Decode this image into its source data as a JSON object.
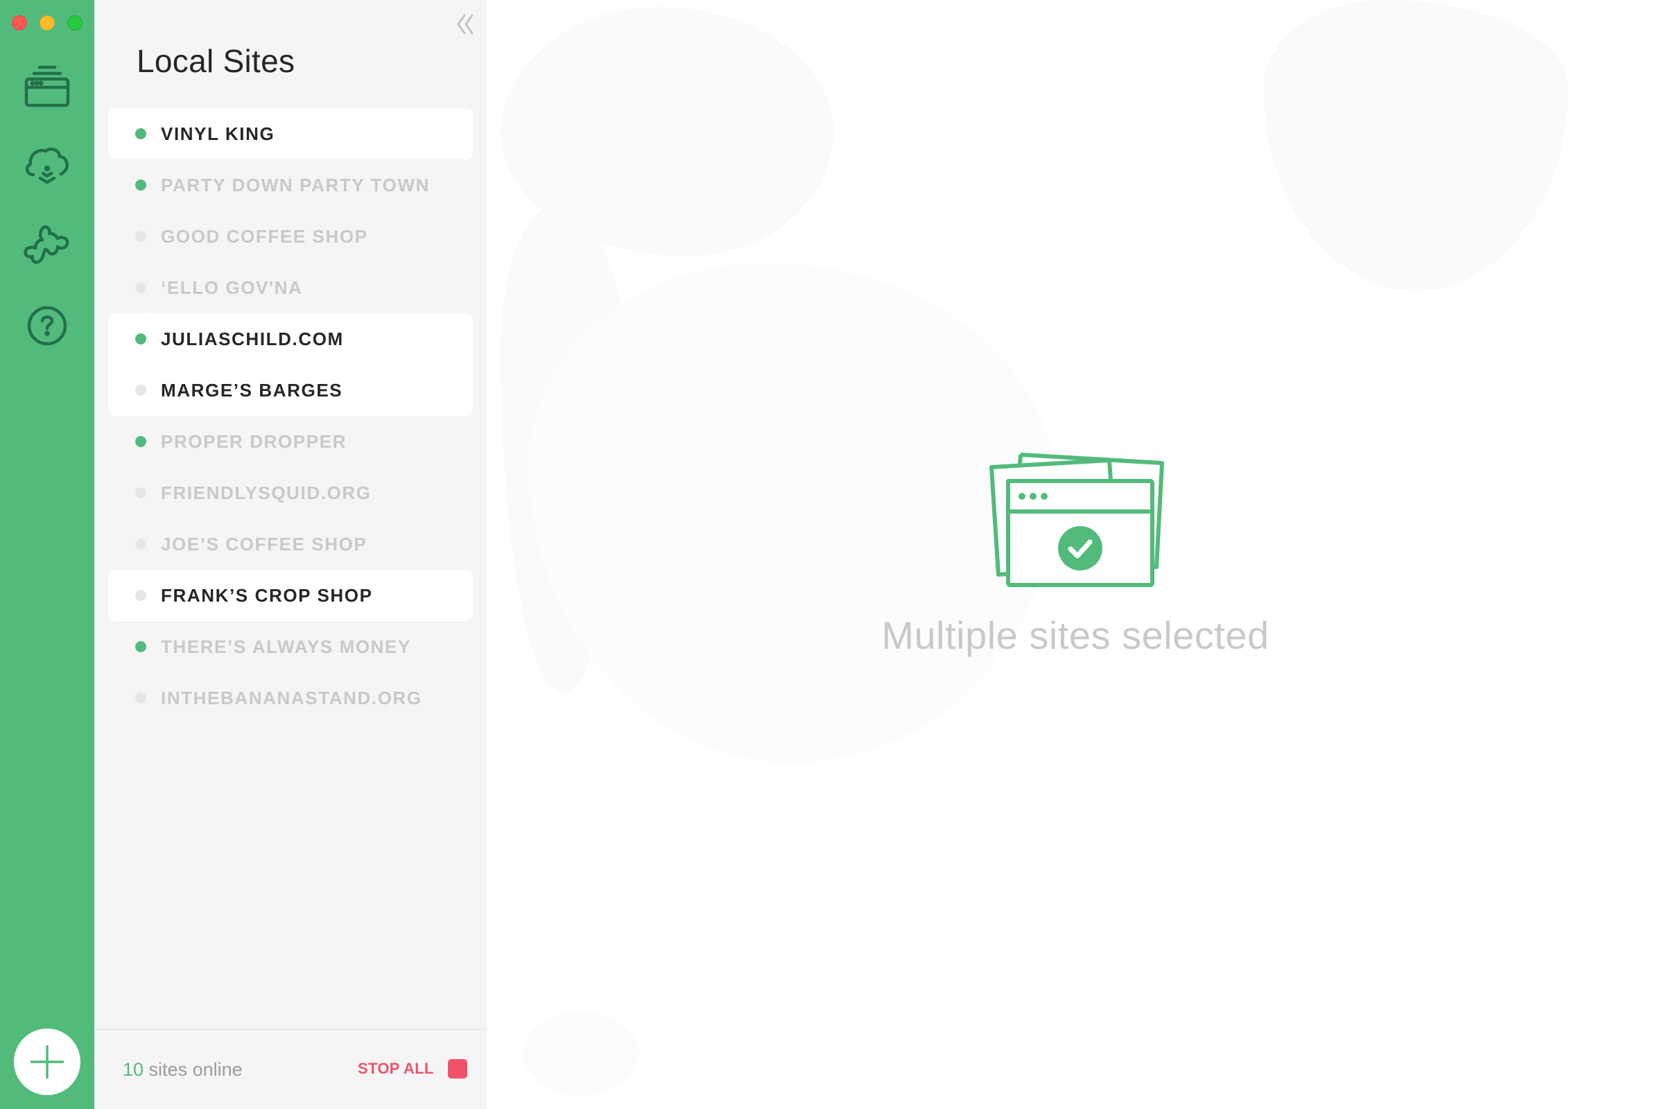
{
  "window": {
    "traffic_lights": [
      "close",
      "minimize",
      "maximize"
    ]
  },
  "rail": {
    "items": [
      {
        "id": "sites",
        "icon": "sites-stack-icon",
        "label": "Local Sites"
      },
      {
        "id": "connect",
        "icon": "cloud-download-icon",
        "label": "Connect"
      },
      {
        "id": "addons",
        "icon": "puzzle-icon",
        "label": "Add-ons"
      },
      {
        "id": "help",
        "icon": "help-circle-icon",
        "label": "Help"
      }
    ],
    "add_button_icon": "plus-icon"
  },
  "panel": {
    "title": "Local Sites",
    "collapse_icon": "double-chevron-left-icon",
    "sites": [
      {
        "name": "VINYL KING",
        "online": true,
        "selected": true
      },
      {
        "name": "PARTY DOWN PARTY TOWN",
        "online": true,
        "selected": false
      },
      {
        "name": "GOOD COFFEE SHOP",
        "online": false,
        "selected": false
      },
      {
        "name": "‘ELLO GOV'NA",
        "online": false,
        "selected": false
      },
      {
        "name": "JULIASCHILD.COM",
        "online": true,
        "selected": true
      },
      {
        "name": "MARGE’S BARGES",
        "online": false,
        "selected": true
      },
      {
        "name": "PROPER DROPPER",
        "online": true,
        "selected": false
      },
      {
        "name": "FRIENDLYSQUID.ORG",
        "online": false,
        "selected": false
      },
      {
        "name": "JOE’S COFFEE SHOP",
        "online": false,
        "selected": false
      },
      {
        "name": "FRANK’S CROP SHOP",
        "online": false,
        "selected": true
      },
      {
        "name": "THERE’S ALWAYS MONEY",
        "online": true,
        "selected": false
      },
      {
        "name": "INTHEBANANASTAND.ORG",
        "online": false,
        "selected": false
      }
    ],
    "footer": {
      "online_count": "10",
      "online_suffix": " sites online",
      "stop_all_label": "STOP ALL"
    }
  },
  "main": {
    "empty_state_icon": "multiple-sites-check-icon",
    "caption": "Multiple sites selected"
  },
  "colors": {
    "brand_green": "#52bb7c",
    "stop_red": "#f0526a",
    "rail_icon": "#22704a",
    "inactive_text": "#c9c9c9",
    "active_text": "#262626"
  }
}
